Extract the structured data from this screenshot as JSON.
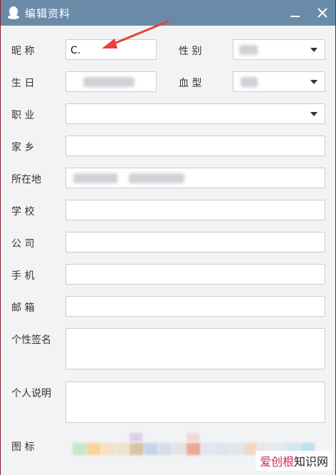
{
  "titlebar": {
    "title": "编辑资料",
    "app_icon": "penguin-icon",
    "minimize_icon": "minimize-icon",
    "close_icon": "close-icon"
  },
  "form": {
    "nickname": {
      "label": "昵  称",
      "value": "C."
    },
    "gender": {
      "label": "性  别"
    },
    "birthday": {
      "label": "生  日"
    },
    "blood_type": {
      "label": "血  型"
    },
    "occupation": {
      "label": "职  业"
    },
    "hometown": {
      "label": "家  乡"
    },
    "location": {
      "label": "所在地"
    },
    "school": {
      "label": "学  校"
    },
    "company": {
      "label": "公  司"
    },
    "phone": {
      "label": "手  机"
    },
    "email": {
      "label": "邮  箱"
    },
    "signature": {
      "label": "个性签名"
    },
    "personal_desc": {
      "label": "个人说明"
    },
    "icons": {
      "label": "图  标"
    }
  },
  "annotation": {
    "arrow_color": "#e8403a"
  },
  "watermark": {
    "brand_mark": "爱创根",
    "brand_rest": "知识网"
  },
  "colors": {
    "titlebar": "#6a8ba8",
    "background": "#f2f3f5"
  }
}
